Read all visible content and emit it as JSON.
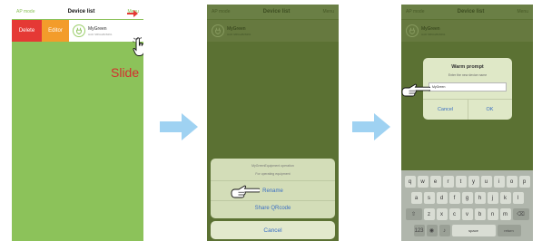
{
  "nav": {
    "left": "AP mode",
    "title": "Device list",
    "right": "Menu"
  },
  "device": {
    "name": "MyGreen",
    "id": "HAD SB9A2828491"
  },
  "screen1": {
    "delete_label": "Delete",
    "editor_label": "Editor",
    "slide_label": "Slide"
  },
  "screen2": {
    "sheet_title": "MyGreenEquipment operation",
    "sheet_subtitle": "For operating equipment",
    "rename_label": "Rename",
    "share_label": "Share QRcode",
    "cancel_label": "Cancel"
  },
  "screen3": {
    "dialog_title": "Warm prompt",
    "dialog_message": "Enter the new device name",
    "input_value": "MyGreen",
    "cancel_label": "Cancel",
    "ok_label": "OK",
    "keyboard": {
      "row1": [
        "q",
        "w",
        "e",
        "r",
        "t",
        "y",
        "u",
        "i",
        "o",
        "p"
      ],
      "row2": [
        "a",
        "s",
        "d",
        "f",
        "g",
        "h",
        "j",
        "k",
        "l"
      ],
      "row3": [
        "z",
        "x",
        "c",
        "v",
        "b",
        "n",
        "m"
      ],
      "space_label": "space",
      "return_label": "return"
    }
  },
  "colors": {
    "green": "#8cc25a",
    "dim_green": "#5b7133",
    "delete_red": "#e53935",
    "editor_orange": "#f39c2b",
    "flow_arrow_blue": "#9fd2f2",
    "ios_blue": "#3a6fc4",
    "slide_red": "#d32f2f"
  },
  "icons": {
    "device": "power-plug-icon",
    "pointer": "pointing-hand-icon",
    "flow": "right-arrow-icon",
    "callout": "red-arrow-icon"
  }
}
